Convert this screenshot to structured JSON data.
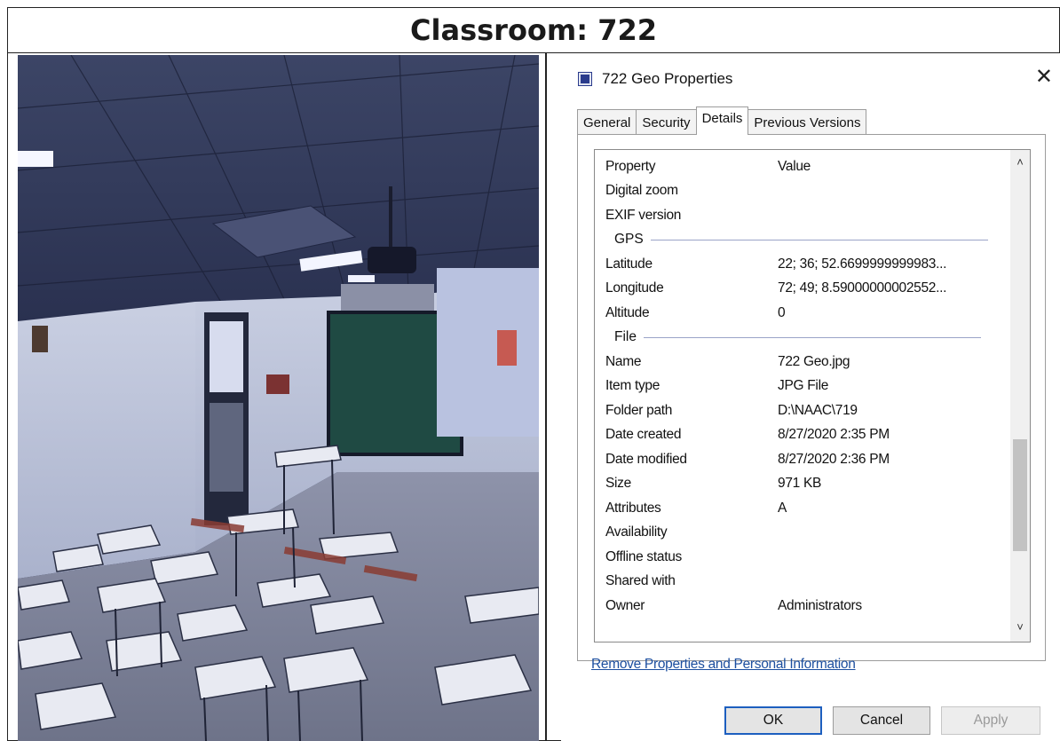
{
  "heading": "Classroom: 722",
  "dialog": {
    "title": "722 Geo Properties",
    "close_glyph": "✕",
    "tabs": [
      {
        "label": "General"
      },
      {
        "label": "Security"
      },
      {
        "label": "Details",
        "active": true
      },
      {
        "label": "Previous Versions"
      }
    ],
    "columns": {
      "property": "Property",
      "value": "Value"
    },
    "rows": [
      {
        "property": "Digital zoom",
        "value": ""
      },
      {
        "property": "EXIF version",
        "value": ""
      },
      {
        "group": "GPS"
      },
      {
        "property": "Latitude",
        "value": "22; 36; 52.6699999999983..."
      },
      {
        "property": "Longitude",
        "value": "72; 49; 8.59000000002552..."
      },
      {
        "property": "Altitude",
        "value": "0"
      },
      {
        "group": "File"
      },
      {
        "property": "Name",
        "value": "722 Geo.jpg"
      },
      {
        "property": "Item type",
        "value": "JPG File"
      },
      {
        "property": "Folder path",
        "value": "D:\\NAAC\\719"
      },
      {
        "property": "Date created",
        "value": "8/27/2020 2:35 PM"
      },
      {
        "property": "Date modified",
        "value": "8/27/2020 2:36 PM"
      },
      {
        "property": "Size",
        "value": "971 KB"
      },
      {
        "property": "Attributes",
        "value": "A"
      },
      {
        "property": "Availability",
        "value": ""
      },
      {
        "property": "Offline status",
        "value": ""
      },
      {
        "property": "Shared with",
        "value": ""
      },
      {
        "property": "Owner",
        "value": "Administrators"
      }
    ],
    "remove_link": "Remove Properties and Personal Information",
    "buttons": {
      "ok": "OK",
      "cancel": "Cancel",
      "apply": "Apply"
    },
    "scroll_position_fraction": 0.78
  },
  "colors": {
    "link": "#1d4f9f",
    "ok_border": "#1d5fbf",
    "icon": "#2a3b8c"
  },
  "icons": {
    "file_icon": "file-properties-icon",
    "scroll_up": "chevron-up-icon",
    "scroll_down": "chevron-down-icon"
  }
}
